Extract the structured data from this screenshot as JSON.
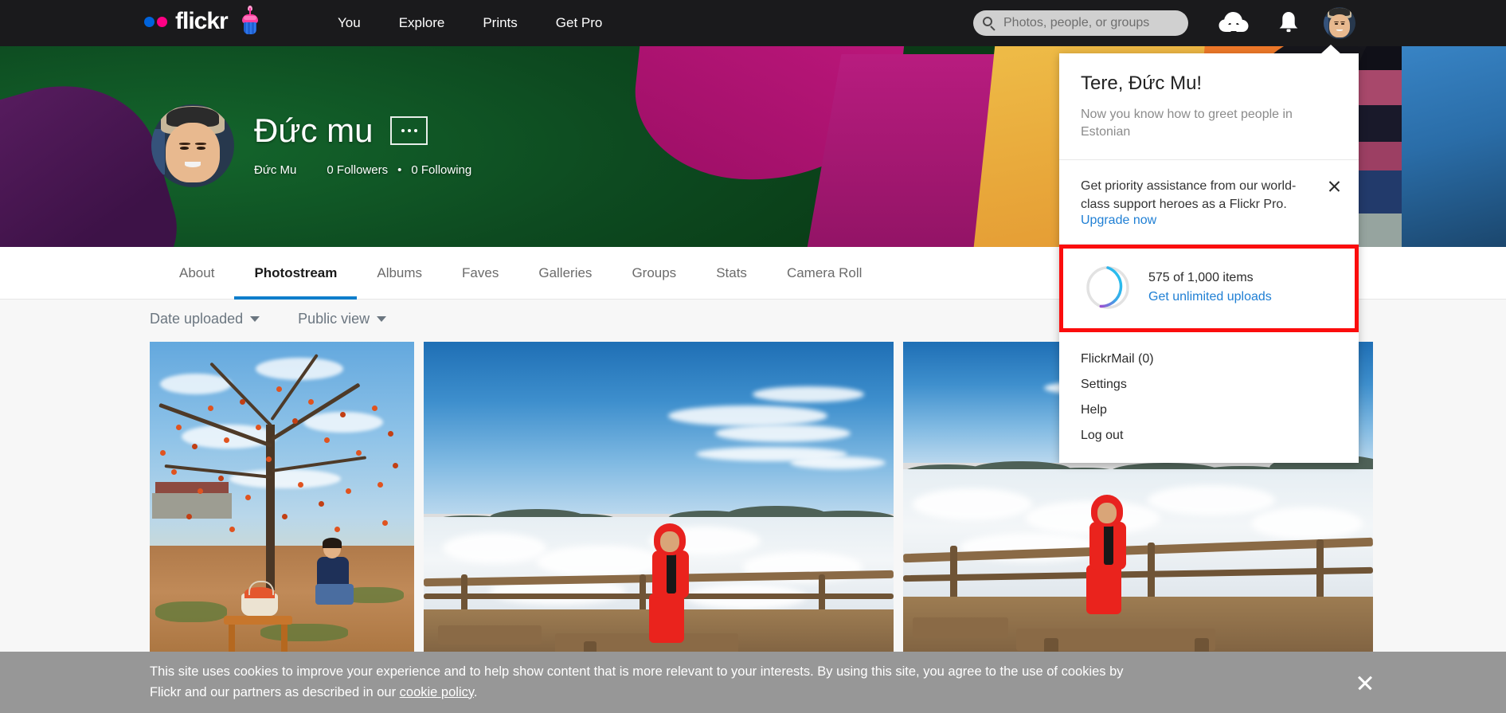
{
  "navbar": {
    "logo_text": "flickr",
    "logo_icon": "flickr-dots-icon",
    "cupcake_icon": "cupcake-icon",
    "links": [
      {
        "label": "You"
      },
      {
        "label": "Explore"
      },
      {
        "label": "Prints"
      },
      {
        "label": "Get Pro"
      }
    ],
    "search": {
      "placeholder": "Photos, people, or groups",
      "value": "",
      "icon": "search-icon"
    },
    "upload_icon": "cloud-upload-icon",
    "notifications_icon": "bell-icon",
    "avatar_icon": "user-avatar"
  },
  "profile": {
    "display_name": "Đức mu",
    "username": "Đức Mu",
    "followers": "0 Followers",
    "following": "0 Following",
    "separator": "•",
    "more_button_icon": "ellipsis-icon"
  },
  "tabs": [
    {
      "label": "About",
      "active": false
    },
    {
      "label": "Photostream",
      "active": true
    },
    {
      "label": "Albums",
      "active": false
    },
    {
      "label": "Faves",
      "active": false
    },
    {
      "label": "Galleries",
      "active": false
    },
    {
      "label": "Groups",
      "active": false
    },
    {
      "label": "Stats",
      "active": false
    },
    {
      "label": "Camera Roll",
      "active": false
    }
  ],
  "filters": [
    {
      "label": "Date uploaded",
      "icon": "chevron-down-icon"
    },
    {
      "label": "Public view",
      "icon": "chevron-down-icon"
    }
  ],
  "dropdown": {
    "greeting": "Tere, Đức Mu!",
    "greeting_sub": "Now you know how to greet people in Estonian",
    "promo_text": "Get priority assistance from our world-class support heroes as a Flickr Pro.",
    "promo_link": "Upgrade now",
    "promo_close_icon": "close-icon",
    "storage": {
      "count_text": "575 of 1,000 items",
      "used": 575,
      "total": 1000,
      "percent": 57.5,
      "link": "Get unlimited uploads",
      "ring_icon": "progress-ring-icon",
      "ring_color_start": "#21c7f0",
      "ring_color_end": "#9b4fd1",
      "ring_track_color": "#e2e2e2",
      "highlight_color": "#fb0d0d"
    },
    "menu": [
      {
        "label": "FlickrMail (0)"
      },
      {
        "label": "Settings"
      },
      {
        "label": "Help"
      },
      {
        "label": "Log out"
      }
    ]
  },
  "cookie_banner": {
    "text_part1": "This site uses cookies to improve your experience and to help show content that is more relevant to your interests. By using this site, you agree to the use of cookies by Flickr and our partners as described in our ",
    "link_label": "cookie policy",
    "text_part2": ".",
    "close_icon": "close-icon"
  },
  "photos": [
    {
      "alt": "Man sitting under persimmon tree"
    },
    {
      "alt": "Person in red suit above sea of clouds"
    },
    {
      "alt": "Person in red suit on wooden deck above clouds"
    }
  ],
  "colors": {
    "navbar_bg": "#1a1a1c",
    "accent_blue": "#0f7ecb",
    "link_blue": "#1f7fd4",
    "page_bg": "#f7f7f7",
    "cookie_bg": "#979797"
  }
}
